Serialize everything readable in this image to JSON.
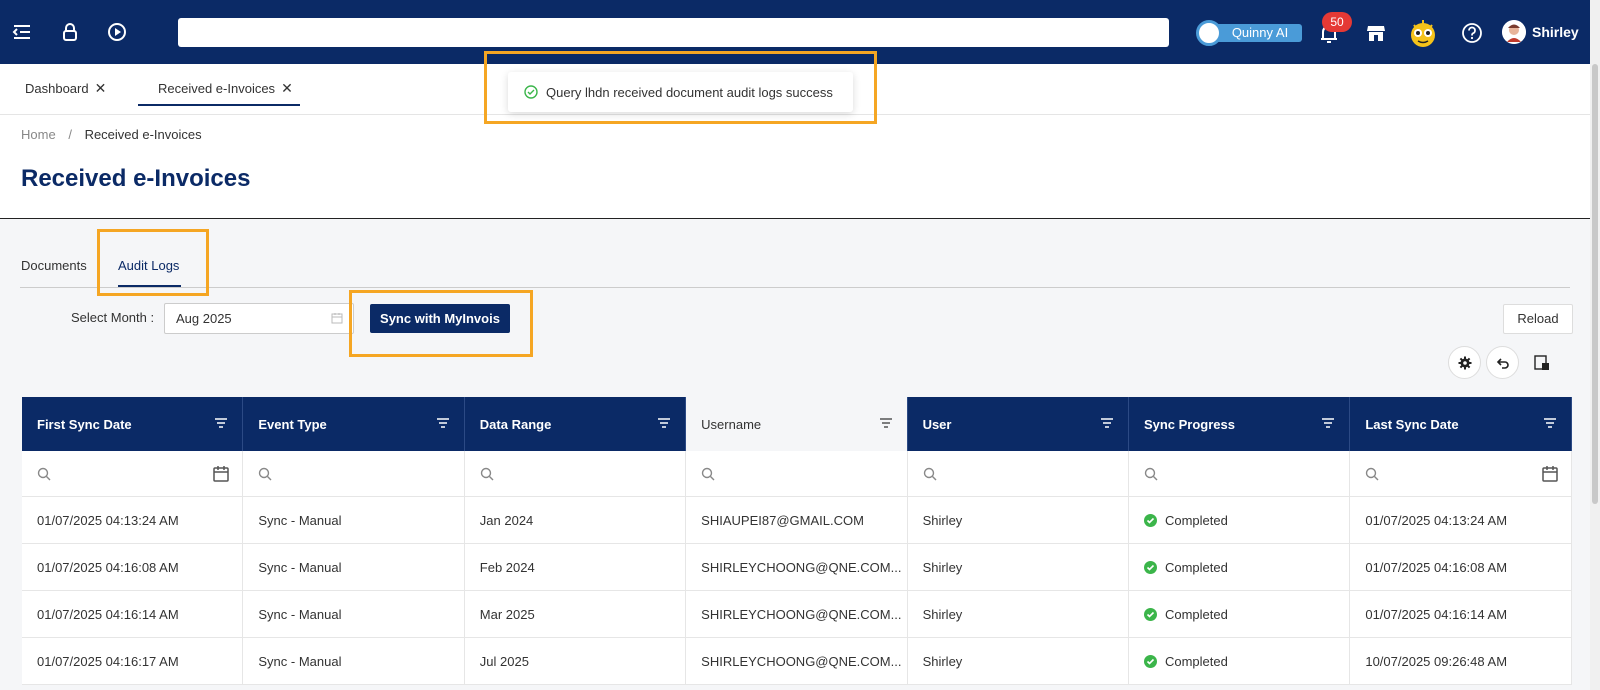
{
  "topbar": {
    "ai_label": "Quinny AI",
    "notification_count": "50",
    "user_name": "Shirley"
  },
  "tabs": [
    {
      "label": "Dashboard"
    },
    {
      "label": "Received e-Invoices"
    }
  ],
  "tab_close": "✕",
  "toast": {
    "message": "Query lhdn received document audit logs success"
  },
  "breadcrumb": {
    "home": "Home",
    "separator": "/",
    "current": "Received e-Invoices"
  },
  "page_title": "Received e-Invoices",
  "subtabs": [
    {
      "label": "Documents"
    },
    {
      "label": "Audit Logs"
    }
  ],
  "filters": {
    "month_label": "Select Month :",
    "month_value": "Aug 2025",
    "sync_label": "Sync with MyInvois",
    "reload_label": "Reload"
  },
  "table": {
    "columns": [
      "First Sync Date",
      "Event Type",
      "Data Range",
      "Username",
      "User",
      "Sync Progress",
      "Last Sync Date"
    ],
    "rows": [
      [
        "01/07/2025 04:13:24 AM",
        "Sync - Manual",
        "Jan 2024",
        "SHIAUPEI87@GMAIL.COM",
        "Shirley",
        "Completed",
        "01/07/2025 04:13:24 AM"
      ],
      [
        "01/07/2025 04:16:08 AM",
        "Sync - Manual",
        "Feb 2024",
        "SHIRLEYCHOONG@QNE.COM...",
        "Shirley",
        "Completed",
        "01/07/2025 04:16:08 AM"
      ],
      [
        "01/07/2025 04:16:14 AM",
        "Sync - Manual",
        "Mar 2025",
        "SHIRLEYCHOONG@QNE.COM...",
        "Shirley",
        "Completed",
        "01/07/2025 04:16:14 AM"
      ],
      [
        "01/07/2025 04:16:17 AM",
        "Sync - Manual",
        "Jul 2025",
        "SHIRLEYCHOONG@QNE.COM...",
        "Shirley",
        "Completed",
        "10/07/2025 09:26:48 AM"
      ]
    ]
  },
  "colors": {
    "brand": "#0b2a66",
    "highlight": "#f5a623",
    "success": "#3bb54a",
    "badge": "#e53935"
  }
}
